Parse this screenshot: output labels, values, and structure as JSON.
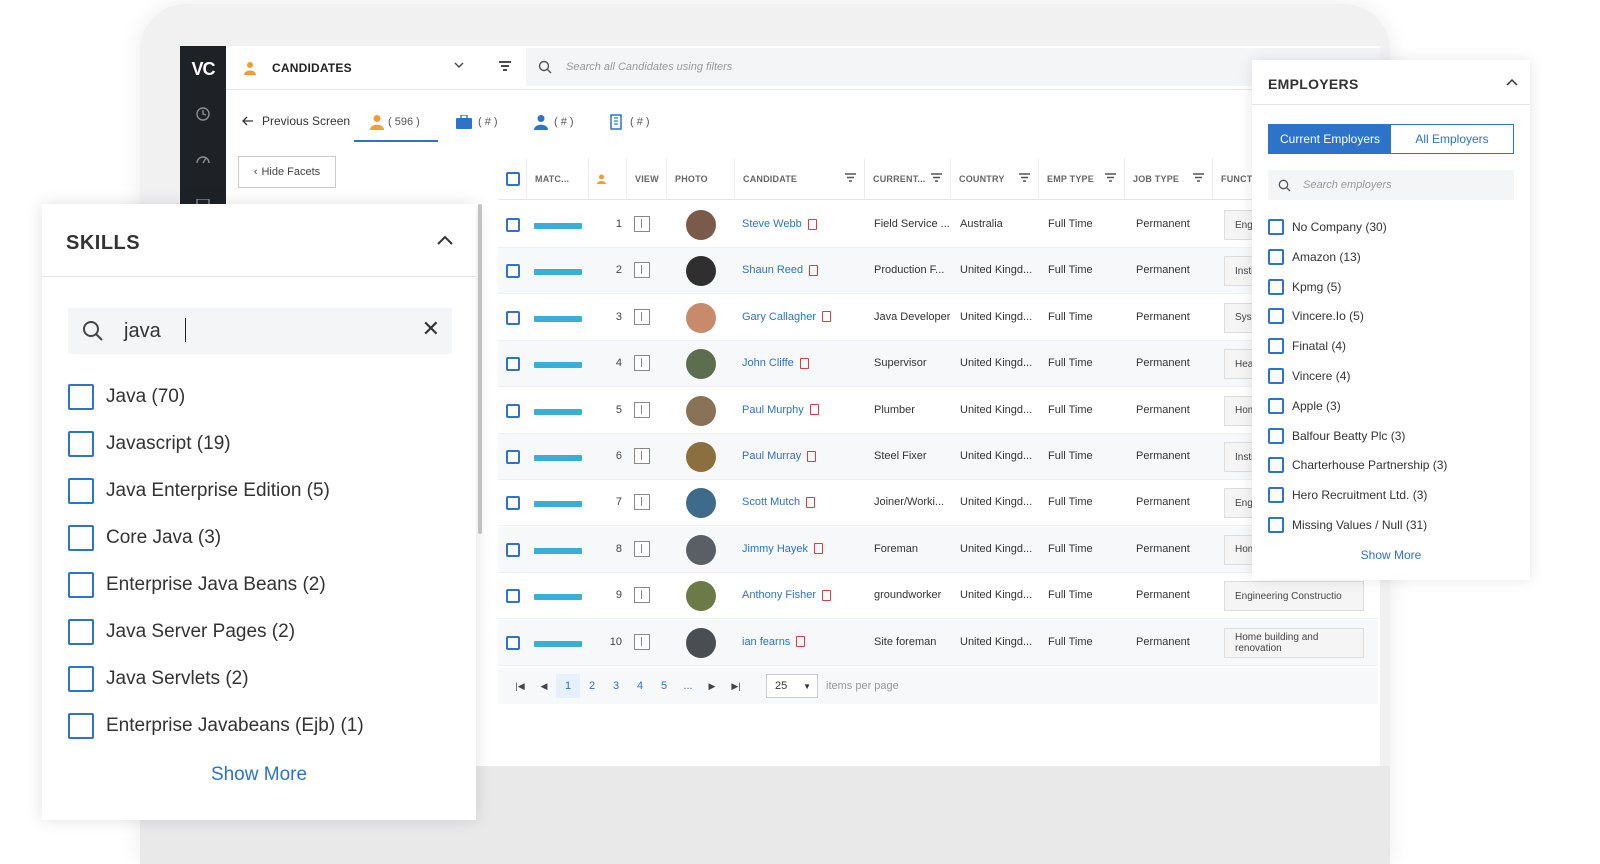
{
  "app": {
    "logo_text": "VC",
    "entity_label": "CANDIDATES",
    "search_placeholder": "Search all Candidates using filters"
  },
  "tabs": {
    "previous_label": "Previous Screen",
    "candidates_count": "( 596 )",
    "jobs_count": "( # )",
    "contacts_count": "( # )",
    "companies_count": "( # )"
  },
  "hide_facets_label": "Hide Facets",
  "grid": {
    "columns": [
      "MATC...",
      "",
      "VIEW",
      "PHOTO",
      "CANDIDATE",
      "CURRENT...",
      "COUNTRY",
      "EMP TYPE",
      "JOB TYPE",
      "FUNCTIO"
    ],
    "rows": [
      {
        "num": "1",
        "name": "Steve Webb",
        "current": "Field Service ...",
        "country": "Australia",
        "emp_type": "Full Time",
        "job_type": "Permanent",
        "function": "Engi"
      },
      {
        "num": "2",
        "name": "Shaun Reed",
        "current": "Production F...",
        "country": "United Kingd...",
        "emp_type": "Full Time",
        "job_type": "Permanent",
        "function": "Instit comi"
      },
      {
        "num": "3",
        "name": "Gary Callagher",
        "current": "Java Developer",
        "country": "United Kingd...",
        "emp_type": "Full Time",
        "job_type": "Permanent",
        "function": "Syste"
      },
      {
        "num": "4",
        "name": "John Cliffe",
        "current": "Supervisor",
        "country": "United Kingd...",
        "emp_type": "Full Time",
        "job_type": "Permanent",
        "function": "Heav"
      },
      {
        "num": "5",
        "name": "Paul Murphy",
        "current": "Plumber",
        "country": "United Kingd...",
        "emp_type": "Full Time",
        "job_type": "Permanent",
        "function": "Hom reno"
      },
      {
        "num": "6",
        "name": "Paul Murray",
        "current": "Steel Fixer",
        "country": "United Kingd...",
        "emp_type": "Full Time",
        "job_type": "Permanent",
        "function": "Instit comi"
      },
      {
        "num": "7",
        "name": "Scott Mutch",
        "current": "Joiner/Worki...",
        "country": "United Kingd...",
        "emp_type": "Full Time",
        "job_type": "Permanent",
        "function": "Engi"
      },
      {
        "num": "8",
        "name": "Jimmy Hayek",
        "current": "Foreman",
        "country": "United Kingd...",
        "emp_type": "Full Time",
        "job_type": "Permanent",
        "function": "Hom reno"
      },
      {
        "num": "9",
        "name": "Anthony Fisher",
        "current": "groundworker",
        "country": "United Kingd...",
        "emp_type": "Full Time",
        "job_type": "Permanent",
        "function": "Engineering Constructio"
      },
      {
        "num": "10",
        "name": "ian fearns",
        "current": "Site foreman",
        "country": "United Kingd...",
        "emp_type": "Full Time",
        "job_type": "Permanent",
        "function": "Home building and renovation"
      }
    ]
  },
  "pager": {
    "pages": [
      "1",
      "2",
      "3",
      "4",
      "5",
      "..."
    ],
    "current_page": "1",
    "per_page": "25",
    "per_page_label": "items per page"
  },
  "skills": {
    "title": "SKILLS",
    "query": "java",
    "items": [
      "Java (70)",
      "Javascript (19)",
      "Java Enterprise Edition (5)",
      "Core Java (3)",
      "Enterprise Java Beans (2)",
      "Java Server Pages (2)",
      "Java Servlets (2)",
      "Enterprise Javabeans (Ejb) (1)"
    ],
    "show_more": "Show More"
  },
  "employers": {
    "title": "EMPLOYERS",
    "toggle_current": "Current Employers",
    "toggle_all": "All Employers",
    "search_placeholder": "Search employers",
    "items": [
      "No Company (30)",
      "Amazon (13)",
      "Kpmg (5)",
      "Vincere.Io (5)",
      "Finatal (4)",
      "Vincere (4)",
      "Apple (3)",
      "Balfour Beatty Plc (3)",
      "Charterhouse Partnership (3)",
      "Hero Recruitment Ltd. (3)",
      "Missing Values / Null (31)"
    ],
    "show_more": "Show More"
  },
  "colors": {
    "accent": "#2c73c9",
    "match_bar": "#3aaed4",
    "nav_bg": "#1e2227",
    "person_icon": "#f39c32"
  }
}
